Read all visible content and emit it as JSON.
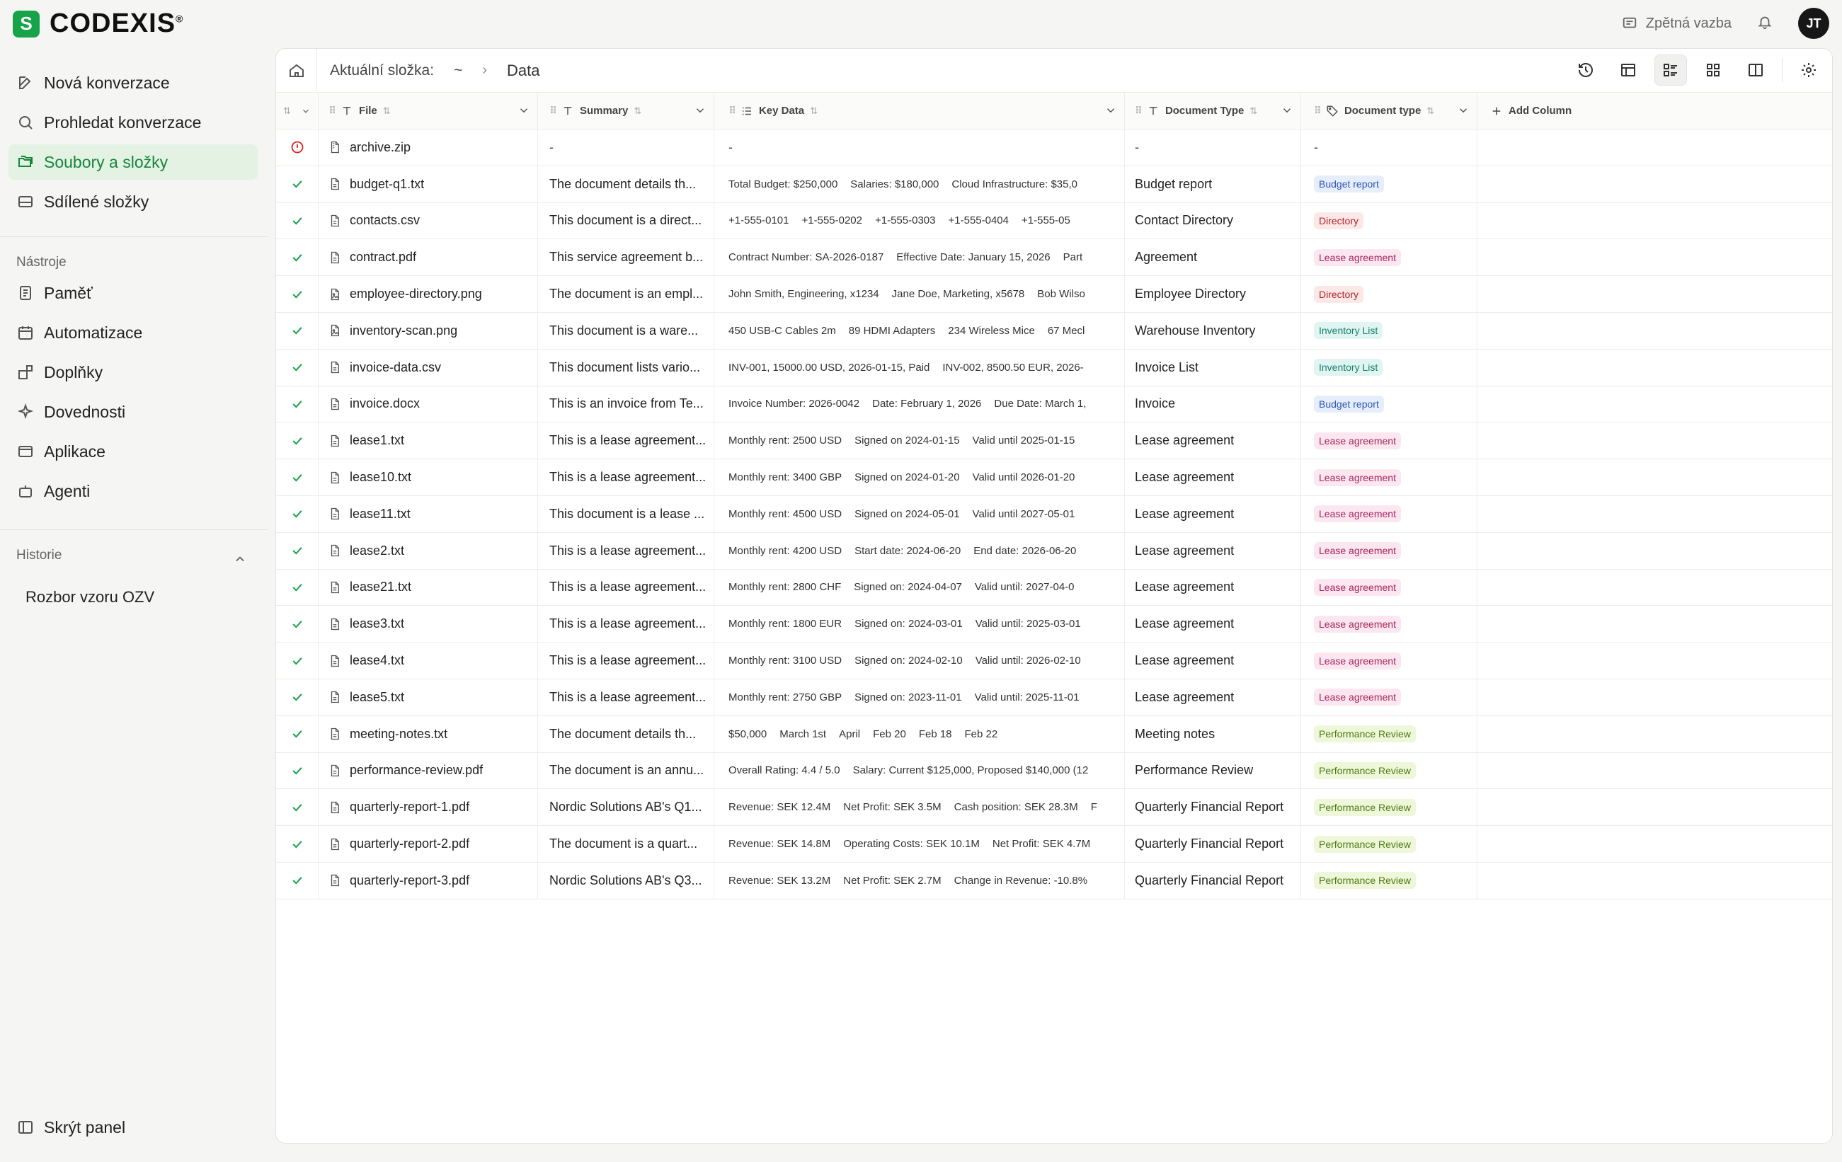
{
  "brand": {
    "name": "CODEXIS",
    "mark": "S",
    "reg": "®"
  },
  "sidebar": {
    "nav": [
      {
        "label": "Nová konverzace",
        "icon": "edit-icon"
      },
      {
        "label": "Prohledat konverzace",
        "icon": "search-icon"
      },
      {
        "label": "Soubory a složky",
        "icon": "folders-icon",
        "active": true
      },
      {
        "label": "Sdílené složky",
        "icon": "drive-icon"
      }
    ],
    "tools_label": "Nástroje",
    "tools": [
      {
        "label": "Paměť",
        "icon": "memory-icon"
      },
      {
        "label": "Automatizace",
        "icon": "calendar-icon"
      },
      {
        "label": "Doplňky",
        "icon": "plugins-icon"
      },
      {
        "label": "Dovednosti",
        "icon": "sparkles-icon"
      },
      {
        "label": "Aplikace",
        "icon": "app-window-icon"
      },
      {
        "label": "Agenti",
        "icon": "bot-icon"
      }
    ],
    "history_label": "Historie",
    "history": [
      "Rozbor vzoru OZV"
    ],
    "hide_panel": "Skrýt panel"
  },
  "topbar": {
    "feedback": "Zpětná vazba",
    "avatar": "JT"
  },
  "breadcrumb": {
    "label": "Aktuální složka:",
    "root": "~",
    "separator": "›",
    "current": "Data"
  },
  "columns": {
    "file": "File",
    "summary": "Summary",
    "key_data": "Key Data",
    "document_type": "Document Type",
    "document_type_tag": "Document type",
    "add_column": "Add Column"
  },
  "tag_colors": {
    "Budget report": {
      "bg": "#e6eefc",
      "fg": "#2f55b5"
    },
    "Directory": {
      "bg": "#fde8e8",
      "fg": "#b4232b"
    },
    "Lease agreement": {
      "bg": "#fce7f0",
      "fg": "#a8245d"
    },
    "Inventory List": {
      "bg": "#e0f5f1",
      "fg": "#16806e"
    },
    "Performance Review": {
      "bg": "#eef7d9",
      "fg": "#4d7a12"
    }
  },
  "rows": [
    {
      "status": "error",
      "file": "archive.zip",
      "icon": "zip-file-icon",
      "summary": "-",
      "key_data": [
        "-"
      ],
      "doc_type": "-",
      "tag": "-"
    },
    {
      "status": "ok",
      "file": "budget-q1.txt",
      "icon": "file-icon",
      "summary": "The document details th...",
      "key_data": [
        "Total Budget: $250,000",
        "Salaries: $180,000",
        "Cloud Infrastructure: $35,0"
      ],
      "doc_type": "Budget report",
      "tag": "Budget report"
    },
    {
      "status": "ok",
      "file": "contacts.csv",
      "icon": "file-icon",
      "summary": "This document is a direct...",
      "key_data": [
        "+1-555-0101",
        "+1-555-0202",
        "+1-555-0303",
        "+1-555-0404",
        "+1-555-05"
      ],
      "doc_type": "Contact Directory",
      "tag": "Directory"
    },
    {
      "status": "ok",
      "file": "contract.pdf",
      "icon": "file-icon",
      "summary": "This service agreement b...",
      "key_data": [
        "Contract Number: SA-2026-0187",
        "Effective Date: January 15, 2026",
        "Part"
      ],
      "doc_type": "Agreement",
      "tag": "Lease agreement"
    },
    {
      "status": "ok",
      "file": "employee-directory.png",
      "icon": "image-file-icon",
      "summary": "The document is an empl...",
      "key_data": [
        "John Smith, Engineering, x1234",
        "Jane Doe, Marketing, x5678",
        "Bob Wilso"
      ],
      "doc_type": "Employee Directory",
      "tag": "Directory"
    },
    {
      "status": "ok",
      "file": "inventory-scan.png",
      "icon": "image-file-icon",
      "summary": "This document is a ware...",
      "key_data": [
        "450 USB-C Cables 2m",
        "89 HDMI Adapters",
        "234 Wireless Mice",
        "67 Mecl"
      ],
      "doc_type": "Warehouse Inventory",
      "tag": "Inventory List"
    },
    {
      "status": "ok",
      "file": "invoice-data.csv",
      "icon": "file-icon",
      "summary": "This document lists vario...",
      "key_data": [
        "INV-001, 15000.00 USD, 2026-01-15, Paid",
        "INV-002, 8500.50 EUR, 2026-"
      ],
      "doc_type": "Invoice List",
      "tag": "Inventory List"
    },
    {
      "status": "ok",
      "file": "invoice.docx",
      "icon": "file-icon",
      "summary": "This is an invoice from Te...",
      "key_data": [
        "Invoice Number: 2026-0042",
        "Date: February 1, 2026",
        "Due Date: March 1,"
      ],
      "doc_type": "Invoice",
      "tag": "Budget report"
    },
    {
      "status": "ok",
      "file": "lease1.txt",
      "icon": "file-icon",
      "summary": "This is a lease agreement...",
      "key_data": [
        "Monthly rent: 2500 USD",
        "Signed on 2024-01-15",
        "Valid until 2025-01-15"
      ],
      "doc_type": "Lease agreement",
      "tag": "Lease agreement"
    },
    {
      "status": "ok",
      "file": "lease10.txt",
      "icon": "file-icon",
      "summary": "This is a lease agreement...",
      "key_data": [
        "Monthly rent: 3400 GBP",
        "Signed on 2024-01-20",
        "Valid until 2026-01-20"
      ],
      "doc_type": "Lease agreement",
      "tag": "Lease agreement"
    },
    {
      "status": "ok",
      "file": "lease11.txt",
      "icon": "file-icon",
      "summary": "This document is a lease ...",
      "key_data": [
        "Monthly rent: 4500 USD",
        "Signed on 2024-05-01",
        "Valid until 2027-05-01"
      ],
      "doc_type": "Lease agreement",
      "tag": "Lease agreement"
    },
    {
      "status": "ok",
      "file": "lease2.txt",
      "icon": "file-icon",
      "summary": "This is a lease agreement...",
      "key_data": [
        "Monthly rent: 4200 USD",
        "Start date: 2024-06-20",
        "End date: 2026-06-20"
      ],
      "doc_type": "Lease agreement",
      "tag": "Lease agreement"
    },
    {
      "status": "ok",
      "file": "lease21.txt",
      "icon": "file-icon",
      "summary": "This is a lease agreement...",
      "key_data": [
        "Monthly rent: 2800 CHF",
        "Signed on: 2024-04-07",
        "Valid until: 2027-04-0"
      ],
      "doc_type": "Lease agreement",
      "tag": "Lease agreement"
    },
    {
      "status": "ok",
      "file": "lease3.txt",
      "icon": "file-icon",
      "summary": "This is a lease agreement...",
      "key_data": [
        "Monthly rent: 1800 EUR",
        "Signed on: 2024-03-01",
        "Valid until: 2025-03-01"
      ],
      "doc_type": "Lease agreement",
      "tag": "Lease agreement"
    },
    {
      "status": "ok",
      "file": "lease4.txt",
      "icon": "file-icon",
      "summary": "This is a lease agreement...",
      "key_data": [
        "Monthly rent: 3100 USD",
        "Signed on: 2024-02-10",
        "Valid until: 2026-02-10"
      ],
      "doc_type": "Lease agreement",
      "tag": "Lease agreement"
    },
    {
      "status": "ok",
      "file": "lease5.txt",
      "icon": "file-icon",
      "summary": "This is a lease agreement...",
      "key_data": [
        "Monthly rent: 2750 GBP",
        "Signed on: 2023-11-01",
        "Valid until: 2025-11-01"
      ],
      "doc_type": "Lease agreement",
      "tag": "Lease agreement"
    },
    {
      "status": "ok",
      "file": "meeting-notes.txt",
      "icon": "file-icon",
      "summary": "The document details th...",
      "key_data": [
        "$50,000",
        "March 1st",
        "April",
        "Feb 20",
        "Feb 18",
        "Feb 22"
      ],
      "doc_type": "Meeting notes",
      "tag": "Performance Review"
    },
    {
      "status": "ok",
      "file": "performance-review.pdf",
      "icon": "file-icon",
      "summary": "The document is an annu...",
      "key_data": [
        "Overall Rating: 4.4 / 5.0",
        "Salary: Current $125,000, Proposed $140,000 (12"
      ],
      "doc_type": "Performance Review",
      "tag": "Performance Review"
    },
    {
      "status": "ok",
      "file": "quarterly-report-1.pdf",
      "icon": "file-icon",
      "summary": "Nordic Solutions AB's Q1...",
      "key_data": [
        "Revenue: SEK 12.4M",
        "Net Profit: SEK 3.5M",
        "Cash position: SEK 28.3M",
        "F"
      ],
      "doc_type": "Quarterly Financial Report",
      "tag": "Performance Review"
    },
    {
      "status": "ok",
      "file": "quarterly-report-2.pdf",
      "icon": "file-icon",
      "summary": "The document is a quart...",
      "key_data": [
        "Revenue: SEK 14.8M",
        "Operating Costs: SEK 10.1M",
        "Net Profit: SEK 4.7M"
      ],
      "doc_type": "Quarterly Financial Report",
      "tag": "Performance Review"
    },
    {
      "status": "ok",
      "file": "quarterly-report-3.pdf",
      "icon": "file-icon",
      "summary": "Nordic Solutions AB's Q3...",
      "key_data": [
        "Revenue: SEK 13.2M",
        "Net Profit: SEK 2.7M",
        "Change in Revenue: -10.8%"
      ],
      "doc_type": "Quarterly Financial Report",
      "tag": "Performance Review"
    }
  ]
}
